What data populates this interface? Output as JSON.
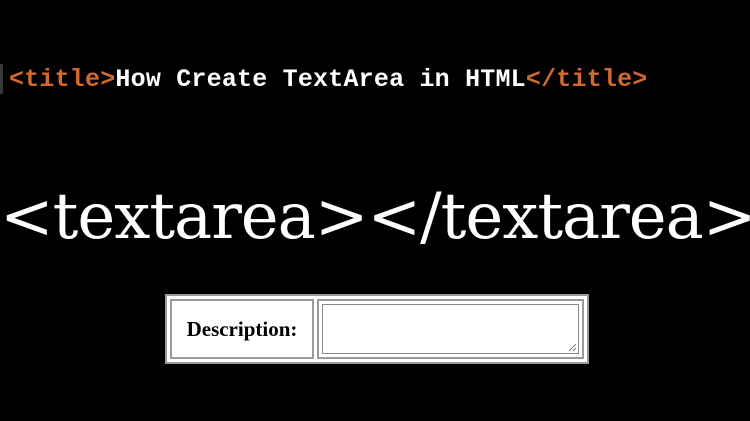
{
  "code_line": {
    "open_tag": "<title>",
    "title": "How Create TextArea in HTML",
    "close_tag": "</title>"
  },
  "headline": {
    "text": "<textarea></textarea>"
  },
  "form": {
    "label": "Description:",
    "textarea_value": ""
  },
  "colors": {
    "background": "#000000",
    "tag": "#d2692f",
    "text": "#ffffff"
  },
  "icons": {
    "resize_grip": "resize-grip-icon"
  }
}
